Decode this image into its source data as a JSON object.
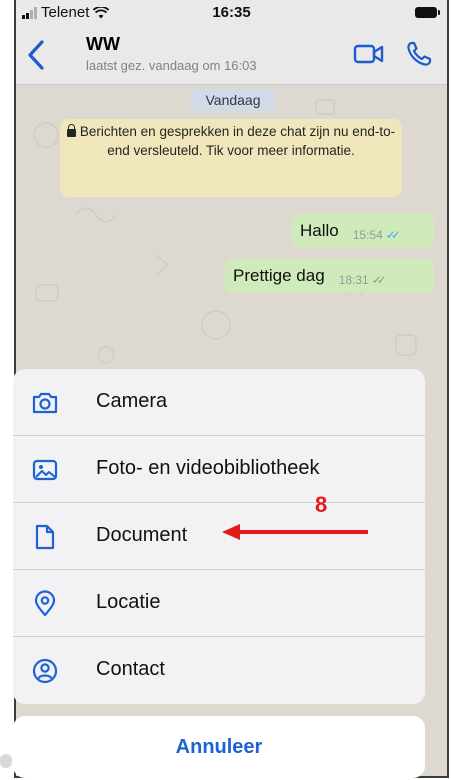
{
  "status_bar": {
    "carrier": "Telenet",
    "time": "16:35"
  },
  "header": {
    "contact_name": "WW",
    "last_seen": "laatst gez. vandaag om 16:03",
    "back_icon": "chevron-left-icon",
    "video_icon": "video-camera-icon",
    "call_icon": "phone-icon",
    "accent_color": "#1e63d6"
  },
  "chat": {
    "date_label": "Vandaag",
    "encryption_notice": "Berichten en gesprekken in deze chat zijn nu end-to-end versleuteld. Tik voor meer informatie.",
    "messages": [
      {
        "text": "Hallo",
        "time": "15:54",
        "status": "read"
      },
      {
        "text": "Prettige dag",
        "time": "18:31",
        "status": "delivered"
      }
    ]
  },
  "attach_menu": {
    "items": [
      {
        "label": "Camera",
        "icon": "camera-icon"
      },
      {
        "label": "Foto- en videobibliotheek",
        "icon": "photo-library-icon"
      },
      {
        "label": "Document",
        "icon": "document-icon"
      },
      {
        "label": "Locatie",
        "icon": "location-icon"
      },
      {
        "label": "Contact",
        "icon": "contact-icon"
      }
    ],
    "cancel_label": "Annuleer"
  },
  "annotation": {
    "step_number": "8",
    "color": "#e31a1a"
  }
}
